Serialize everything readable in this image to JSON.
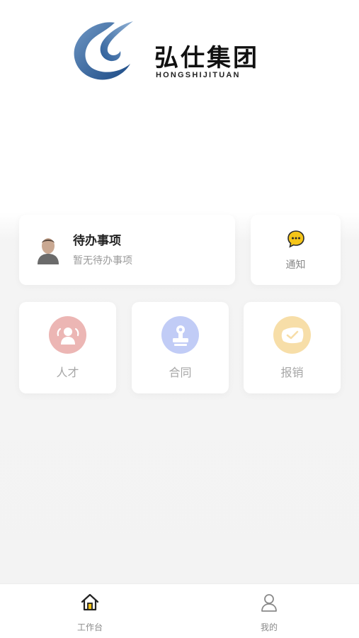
{
  "brand": {
    "name_cn": "弘仕集团",
    "name_en": "HONGSHIJITUAN",
    "logo_icon": "swirl-logo-icon",
    "colors": {
      "logo_blue_dark": "#1f4f88",
      "logo_blue_light": "#5d89b8"
    }
  },
  "todo": {
    "title": "待办事项",
    "subtitle": "暂无待办事项",
    "avatar_icon": "user-avatar-icon"
  },
  "notice": {
    "label": "通知",
    "icon": "chat-bubble-icon",
    "color": "#f5c518"
  },
  "tiles": [
    {
      "label": "人才",
      "icon": "people-icon",
      "color": "#ecb6b4"
    },
    {
      "label": "合同",
      "icon": "stamp-icon",
      "color": "#c1ccf6"
    },
    {
      "label": "报销",
      "icon": "ticket-check-icon",
      "color": "#f7dea8"
    }
  ],
  "tabbar": {
    "items": [
      {
        "label": "工作台",
        "icon": "home-icon",
        "active": true
      },
      {
        "label": "我的",
        "icon": "person-icon",
        "active": false
      }
    ]
  }
}
